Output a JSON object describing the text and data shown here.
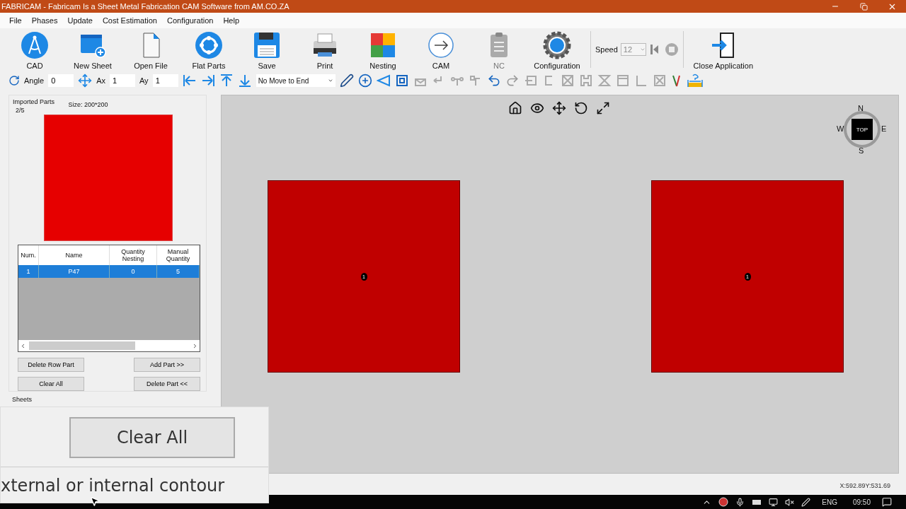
{
  "window": {
    "title": "FABRICAM - Fabricam Is a Sheet Metal Fabrication CAM Software from AM.CO.ZA"
  },
  "menu": [
    "File",
    "Phases",
    "Update",
    "Cost Estimation",
    "Configuration",
    "Help"
  ],
  "main_toolbar": {
    "buttons": [
      {
        "kind": "cad",
        "label": "CAD",
        "disabled": false
      },
      {
        "kind": "new_sheet",
        "label": "New Sheet",
        "disabled": false
      },
      {
        "kind": "open_file",
        "label": "Open File",
        "disabled": false
      },
      {
        "kind": "flat_parts",
        "label": "Flat Parts",
        "disabled": false
      },
      {
        "kind": "save",
        "label": "Save",
        "disabled": false
      },
      {
        "kind": "print",
        "label": "Print",
        "disabled": false
      },
      {
        "kind": "nesting",
        "label": "Nesting",
        "disabled": false
      },
      {
        "kind": "cam",
        "label": "CAM",
        "disabled": false
      },
      {
        "kind": "nc",
        "label": "NC",
        "disabled": true
      },
      {
        "kind": "configuration",
        "label": "Configuration",
        "disabled": false
      }
    ],
    "speed": {
      "label": "Speed",
      "value": "12"
    },
    "close": "Close Application"
  },
  "tool_row": {
    "angle": {
      "label": "Angle",
      "value": "0"
    },
    "ax": {
      "label": "Ax",
      "value": "1"
    },
    "ay": {
      "label": "Ay",
      "value": "1"
    },
    "move_mode": "No Move to End"
  },
  "imported_parts": {
    "title": "Imported Parts",
    "count": "2/5",
    "size": "Size: 200*200",
    "columns": [
      "Num.",
      "Name",
      "Quantity Nesting",
      "Manual Quantity"
    ],
    "rows": [
      {
        "cells": [
          "1",
          "P47",
          "0",
          "5"
        ],
        "selected": true
      }
    ],
    "buttons": [
      "Delete Row Part",
      "Add Part >>",
      "Clear All",
      "Delete Part <<"
    ]
  },
  "sheets": {
    "title": "Sheets"
  },
  "viewer": {
    "compass": {
      "face": "TOP",
      "north": "N",
      "west": "W",
      "east": "E",
      "south": "S"
    },
    "parts": [
      {
        "label": "1"
      },
      {
        "label": "1"
      }
    ]
  },
  "coordinates": "X:592.89Y:531.69",
  "overlay": {
    "button": "Clear All",
    "caption": "xternal or internal contour"
  },
  "taskbar": {
    "language": "ENG",
    "time": "09:50"
  }
}
